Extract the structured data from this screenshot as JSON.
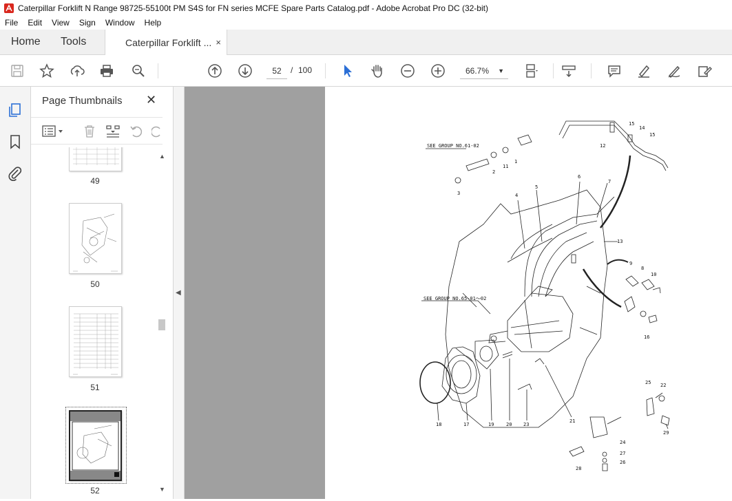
{
  "window": {
    "title": "Caterpillar Forklift N Range  98725-55100t PM S4S for FN series MCFE Spare Parts Catalog.pdf - Adobe Acrobat Pro DC (32-bit)"
  },
  "menu": [
    "File",
    "Edit",
    "View",
    "Sign",
    "Window",
    "Help"
  ],
  "tabs": {
    "home": "Home",
    "tools": "Tools",
    "document": "Caterpillar Forklift ...",
    "close": "×"
  },
  "toolbar": {
    "page_current": "52",
    "page_separator": "/",
    "page_total": "100",
    "zoom": "66.7%",
    "icons": [
      "save-icon",
      "bookmark-star-icon",
      "upload-icon",
      "print-icon",
      "search-icon",
      "page-up-icon",
      "page-down-icon",
      "select-arrow-icon",
      "hand-icon",
      "zoom-out-icon",
      "zoom-in-icon",
      "fit-page-icon",
      "scroll-mode-icon",
      "comment-icon",
      "highlight-icon",
      "sign-icon",
      "fill-sign-icon"
    ]
  },
  "thumbnails": {
    "header": "Page Thumbnails",
    "close": "✕",
    "pages": [
      {
        "label": "49"
      },
      {
        "label": "50"
      },
      {
        "label": "51"
      },
      {
        "label": "52",
        "selected": true
      }
    ]
  },
  "drawing": {
    "refs": [
      "SEE GROUP NO.61-02",
      "SEE GROUP NO.65-01～02"
    ],
    "part_numbers": [
      "1",
      "2",
      "3",
      "4",
      "5",
      "6",
      "7",
      "8",
      "9",
      "10",
      "11",
      "12",
      "13",
      "14",
      "15",
      "15",
      "16",
      "17",
      "18",
      "19",
      "20",
      "21",
      "22",
      "23",
      "24",
      "25",
      "26",
      "27",
      "28",
      "29"
    ]
  },
  "colors": {
    "accent": "#2b6fd6",
    "acrobat_red": "#d9281e",
    "gray_canvas": "#a0a0a0"
  }
}
